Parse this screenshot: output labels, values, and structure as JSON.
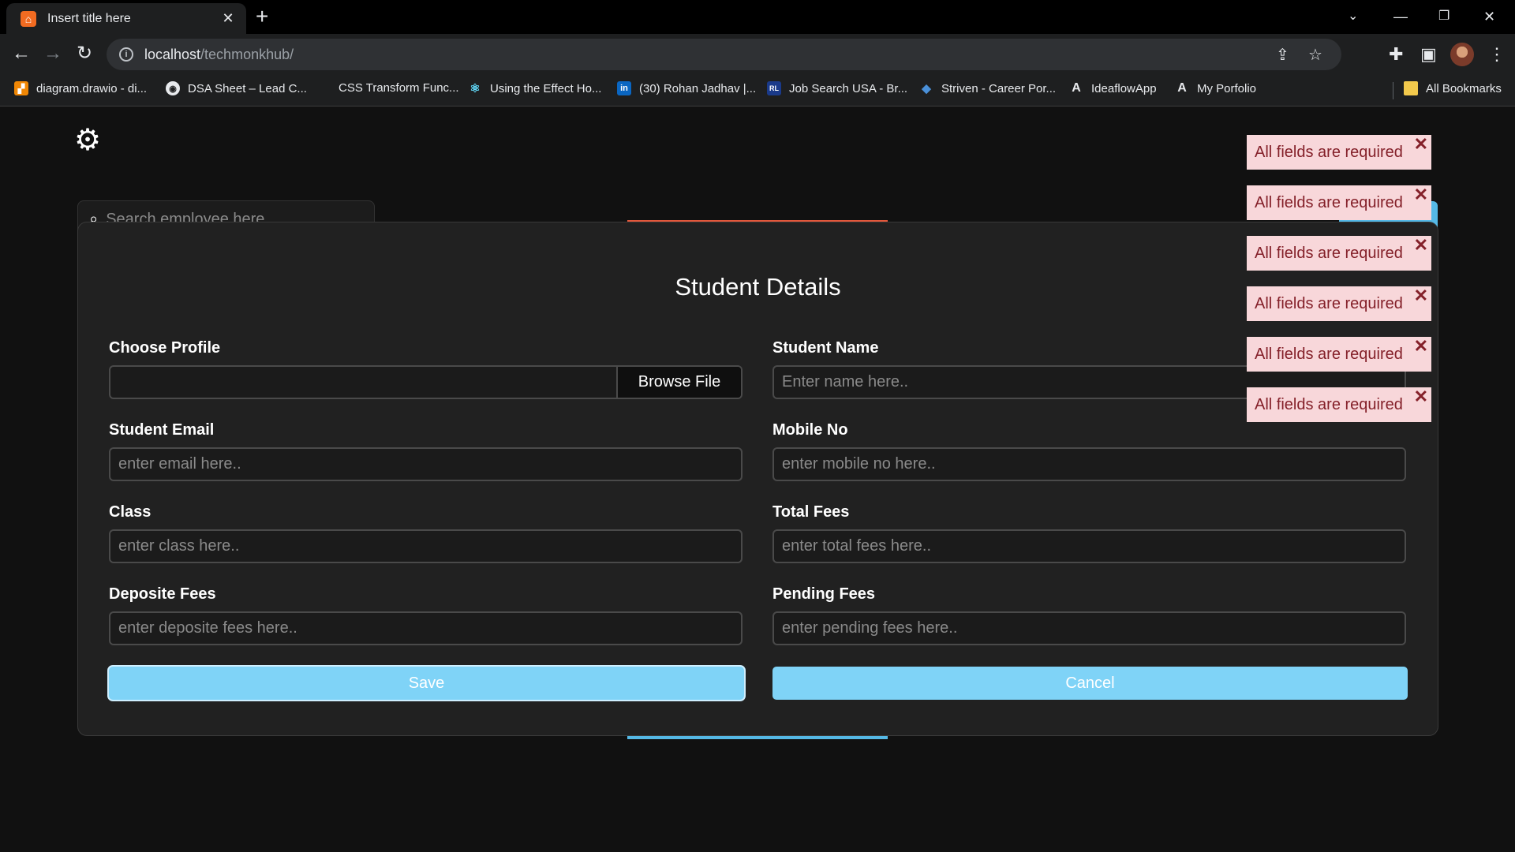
{
  "browser": {
    "tab_title": "Insert title here",
    "tab_favicon": "xampp-icon",
    "url_host": "localhost",
    "url_path": "/techmonkhub/",
    "bookmarks": [
      {
        "label": "diagram.drawio - di...",
        "icon": "drawio-icon",
        "color": "#f08705"
      },
      {
        "label": "DSA Sheet – Lead C...",
        "icon": "globe-icon",
        "color": "#e8eaed"
      },
      {
        "label": "CSS Transform Func...",
        "icon": "none",
        "color": "#e8eaed"
      },
      {
        "label": "Using the Effect Ho...",
        "icon": "react-icon",
        "color": "#61dafb"
      },
      {
        "label": "(30) Rohan Jadhav |...",
        "icon": "linkedin-icon",
        "color": "#0a66c2"
      },
      {
        "label": "Job Search USA - Br...",
        "icon": "rl-icon",
        "color": "#1a3a8a"
      },
      {
        "label": "Striven - Career Por...",
        "icon": "striven-icon",
        "color": "#4a90d9"
      },
      {
        "label": "IdeaflowApp",
        "icon": "a-icon",
        "color": "#e8eaed"
      },
      {
        "label": "My Porfolio",
        "icon": "a-icon",
        "color": "#e8eaed"
      }
    ],
    "all_bookmarks": "All Bookmarks"
  },
  "page": {
    "search_placeholder": "Search employee here..."
  },
  "modal": {
    "title": "Student Details",
    "fields": {
      "profile": {
        "label": "Choose Profile",
        "browse": "Browse File"
      },
      "name": {
        "label": "Student Name",
        "placeholder": "Enter name here.."
      },
      "email": {
        "label": "Student Email",
        "placeholder": "enter email here.."
      },
      "mobile": {
        "label": "Mobile No",
        "placeholder": "enter mobile no here.."
      },
      "class": {
        "label": "Class",
        "placeholder": "enter class here.."
      },
      "total_fees": {
        "label": "Total Fees",
        "placeholder": "enter total fees here.."
      },
      "deposite_fees": {
        "label": "Deposite Fees",
        "placeholder": "enter deposite fees here.."
      },
      "pending_fees": {
        "label": "Pending Fees",
        "placeholder": "enter pending fees here.."
      }
    },
    "save_label": "Save",
    "cancel_label": "Cancel"
  },
  "toasts": [
    {
      "text": "All fields are required"
    },
    {
      "text": "All fields are required"
    },
    {
      "text": "All fields are required"
    },
    {
      "text": "All fields are required"
    },
    {
      "text": "All fields are required"
    },
    {
      "text": "All fields are required"
    }
  ],
  "colors": {
    "accent": "#7fd3f7",
    "toast_bg": "#f8d7da",
    "toast_text": "#842029",
    "modal_bg": "#212121"
  }
}
